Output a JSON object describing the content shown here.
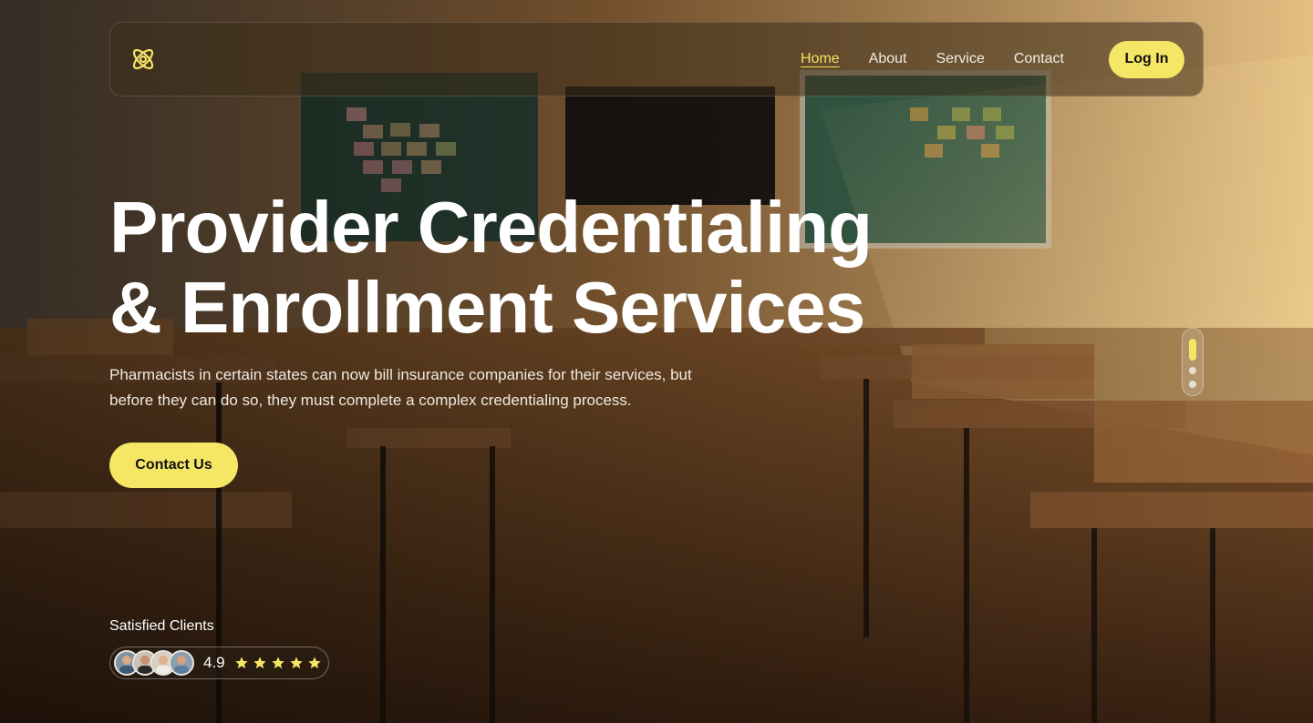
{
  "nav": {
    "links": [
      {
        "label": "Home",
        "active": true
      },
      {
        "label": "About",
        "active": false
      },
      {
        "label": "Service",
        "active": false
      },
      {
        "label": "Contact",
        "active": false
      }
    ],
    "login_label": "Log In",
    "logo_icon": "atom-icon"
  },
  "hero": {
    "title_line1": "Provider Credentialing",
    "title_line2": "& Enrollment Services",
    "description": "Pharmacists in certain states can now bill insurance companies for their services, but before they can do so, they must complete a complex credentialing process.",
    "cta_label": "Contact Us"
  },
  "slider": {
    "slides": 3,
    "active_index": 0
  },
  "clients": {
    "label": "Satisfied Clients",
    "rating": "4.9",
    "stars": 5,
    "avatar_count": 4
  },
  "colors": {
    "accent": "#f6e665",
    "background": "#3a2410"
  }
}
